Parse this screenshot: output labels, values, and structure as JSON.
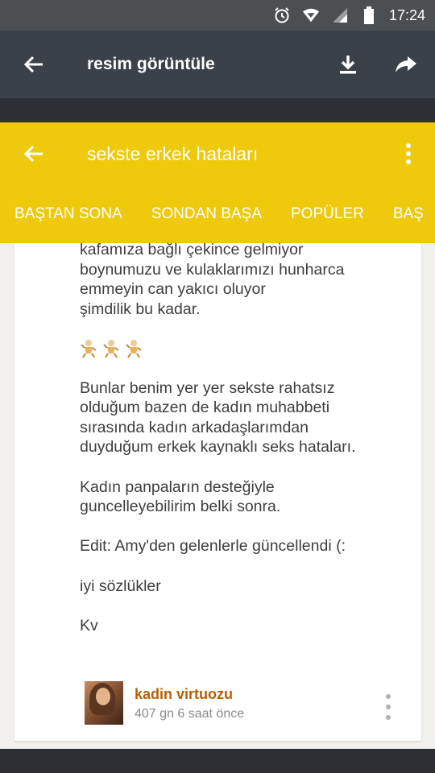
{
  "status_bar": {
    "time": "17:24"
  },
  "viewer": {
    "title": "resim görüntüle"
  },
  "app_bar": {
    "title": "sekste erkek hataları",
    "tabs": [
      {
        "label": "BAŞTAN SONA"
      },
      {
        "label": "SONDAN BAŞA"
      },
      {
        "label": "POPÜLER"
      },
      {
        "label": "BAŞ"
      }
    ]
  },
  "entry": {
    "top_lines": [
      "kafamıza bağlı çekince gelmiyor",
      "boynumuzu ve kulaklarımızı hunharca",
      "emmeyin can yakıcı oluyor",
      "şimdilik bu kadar."
    ],
    "paragraph2": [
      "Bunlar benim yer yer sekste rahatsız",
      "olduğum bazen de kadın muhabbeti",
      "sırasında kadın arkadaşlarımdan",
      "duyduğum erkek kaynaklı seks hataları."
    ],
    "paragraph3": [
      "Kadın panpaların desteğiyle",
      "guncelleyebilirim belki sonra."
    ],
    "edit_note": "Edit: Amy'den gelenlerle güncellendi (:",
    "closing": "iyi sözlükler",
    "signoff": "Kv"
  },
  "author": {
    "name": "kadin virtuozu",
    "time_ago": "407 gn 6 saat  önce"
  }
}
